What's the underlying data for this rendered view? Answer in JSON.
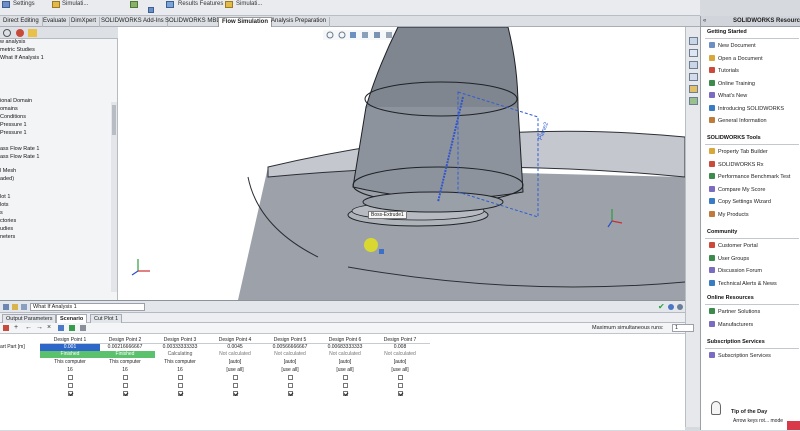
{
  "ribbon": {
    "settings_label": "Settings",
    "simulation_label": "Simulati...",
    "results_features_label": "Results Features",
    "simulation2_label": "Simulati...",
    "more_label": "..."
  },
  "tabs": [
    {
      "label": "Direct Editing"
    },
    {
      "label": "Evaluate"
    },
    {
      "label": "DimXpert"
    },
    {
      "label": "SOLIDWORKS Add-Ins"
    },
    {
      "label": "SOLIDWORKS MBD"
    },
    {
      "label": "Flow Simulation"
    },
    {
      "label": "Analysis Preparation"
    }
  ],
  "left_tree": [
    "w analysis",
    "metric Studies",
    "What If Analysis 1",
    "ional Domain",
    "omains",
    "Conditions",
    "Pressure 1",
    "Pressure 1",
    "ass Flow Rate 1",
    "ass Flow Rate 1",
    "l Mesh",
    "aded)",
    "lot 1",
    "lots",
    "s",
    "ctories",
    "udies",
    "neters"
  ],
  "viewport": {
    "feature_label": "Boss-Extrude1",
    "plane_label": "Plane2"
  },
  "task_pane": {
    "title": "SOLIDWORKS Resources",
    "sections": [
      {
        "title": "Getting Started",
        "items": [
          "New Document",
          "Open a Document",
          "Tutorials",
          "Online Training",
          "What's New",
          "Introducing SOLIDWORKS",
          "General Information"
        ]
      },
      {
        "title": "SOLIDWORKS Tools",
        "items": [
          "Property Tab Builder",
          "SOLIDWORKS Rx",
          "Performance Benchmark Test",
          "Compare My Score",
          "Copy Settings Wizard",
          "My Products"
        ]
      },
      {
        "title": "Community",
        "items": [
          "Customer Portal",
          "User Groups",
          "Discussion Forum",
          "Technical Alerts & News"
        ]
      },
      {
        "title": "Online Resources",
        "items": [
          "Partner Solutions",
          "Manufacturers"
        ]
      },
      {
        "title": "Subscription Services",
        "items": [
          "Subscription Services"
        ]
      }
    ],
    "tip_title": "Tip of the Day",
    "tip_text": "Arrow keys rot... mode"
  },
  "bottom": {
    "study_name": "What If Analysis 1",
    "tabs": [
      {
        "label": "Output Parameters"
      },
      {
        "label": "Scenario"
      },
      {
        "label": "Cut Plot 1"
      }
    ],
    "max_runs_label": "Maximum simultaneous runs:",
    "max_runs_value": "1",
    "row_label": "art Part [m]",
    "columns": [
      {
        "header": "Design Point 1",
        "value": "0.001",
        "status": "Finished",
        "computer": "This computer",
        "cores": "16",
        "checks": [
          false,
          false,
          true
        ]
      },
      {
        "header": "Design Point 2",
        "value": "0.00216666667",
        "status": "Finished",
        "computer": "This computer",
        "cores": "16",
        "checks": [
          false,
          false,
          true
        ]
      },
      {
        "header": "Design Point 3",
        "value": "0.00333333333",
        "status": "Calculating",
        "computer": "This computer",
        "cores": "16",
        "checks": [
          false,
          false,
          true
        ]
      },
      {
        "header": "Design Point 4",
        "value": "0.0045",
        "status": "Not calculated",
        "computer": "[auto]",
        "cores": "[use all]",
        "checks": [
          false,
          false,
          true
        ]
      },
      {
        "header": "Design Point 5",
        "value": "0.00566666667",
        "status": "Not calculated",
        "computer": "[auto]",
        "cores": "[use all]",
        "checks": [
          false,
          false,
          true
        ]
      },
      {
        "header": "Design Point 6",
        "value": "0.00683333333",
        "status": "Not calculated",
        "computer": "[auto]",
        "cores": "[use all]",
        "checks": [
          false,
          false,
          true
        ]
      },
      {
        "header": "Design Point 7",
        "value": "0.008",
        "status": "Not calculated",
        "computer": "[auto]",
        "cores": "[use all]",
        "checks": [
          false,
          false,
          true
        ]
      }
    ]
  }
}
